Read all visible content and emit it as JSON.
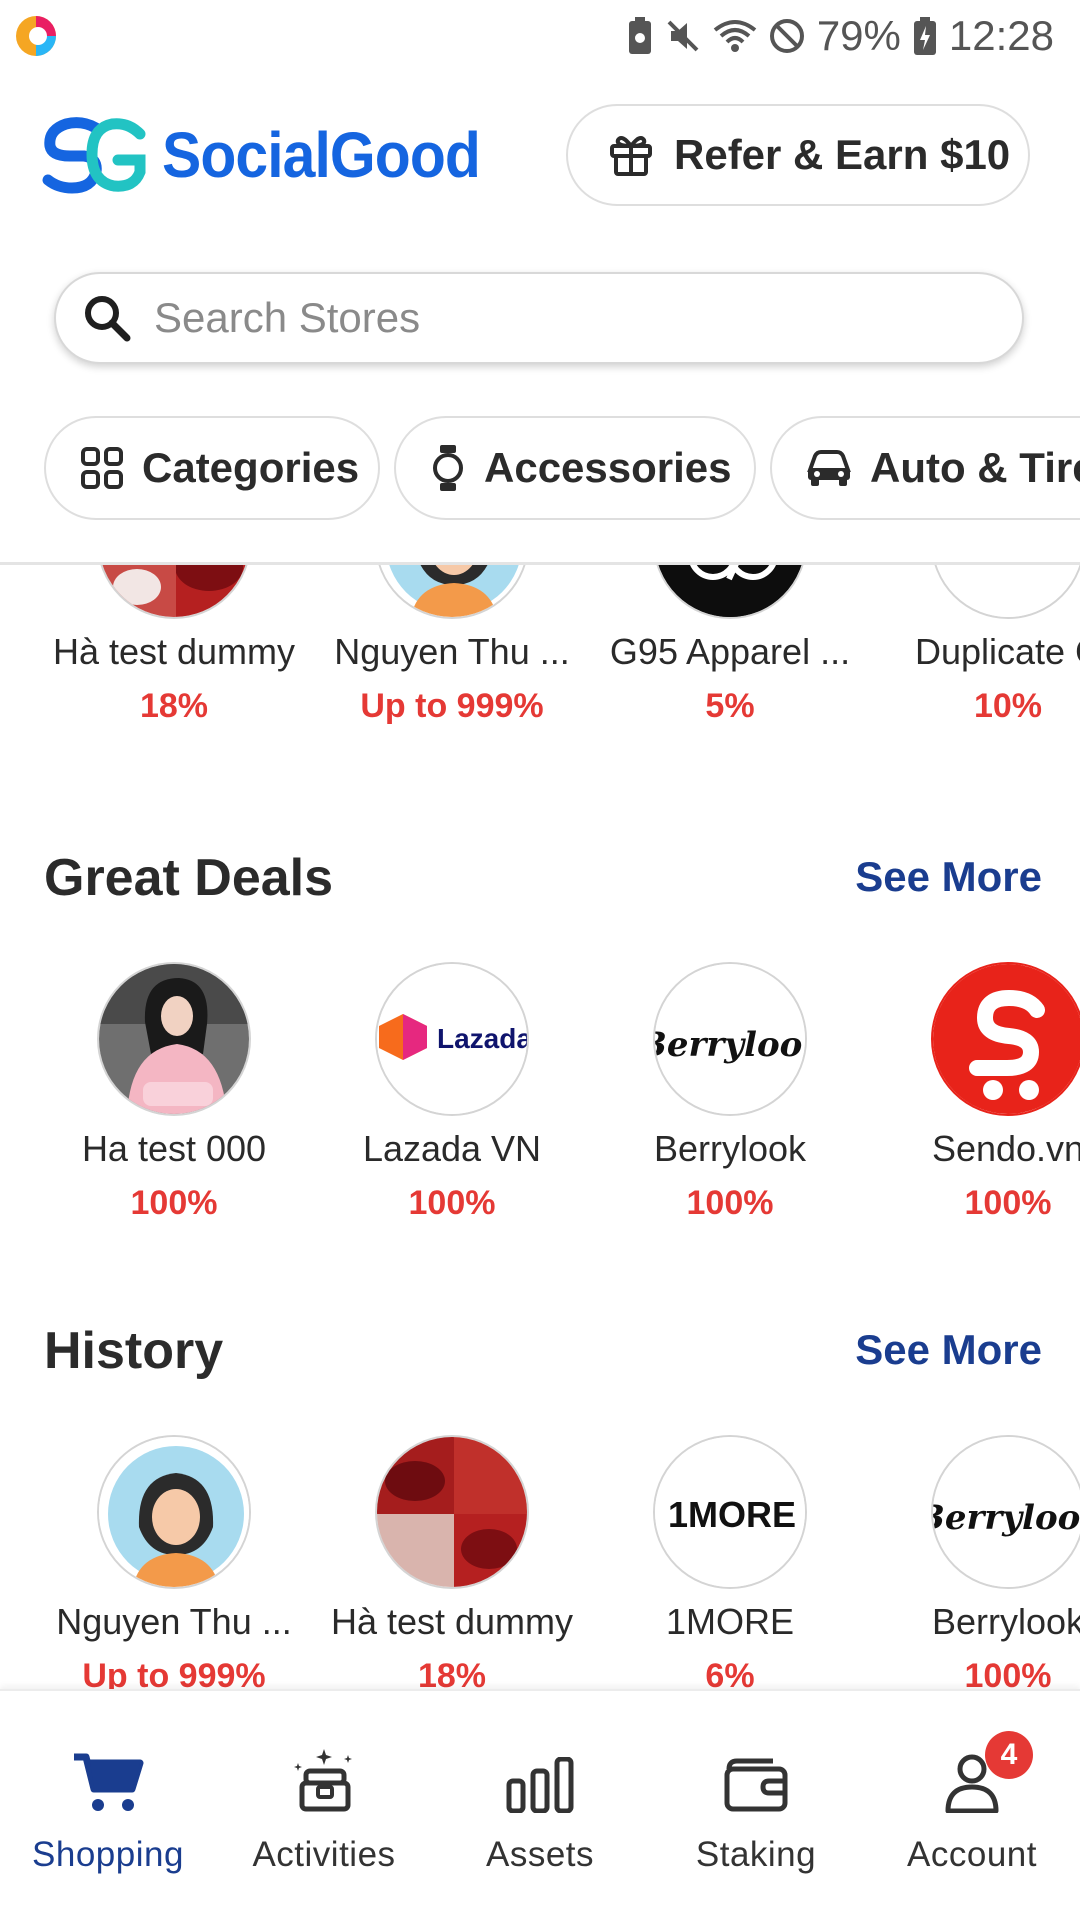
{
  "status_bar": {
    "battery": "79%",
    "time": "12:28"
  },
  "header": {
    "logo_text": "SocialGood",
    "refer_label": "Refer & Earn $10"
  },
  "search": {
    "placeholder": "Search Stores"
  },
  "chips": [
    {
      "label": "Categories",
      "icon": "grid-icon"
    },
    {
      "label": "Accessories",
      "icon": "watch-icon"
    },
    {
      "label": "Auto & Tire",
      "icon": "car-icon"
    }
  ],
  "top_row": [
    {
      "name": "Hà test dummy",
      "rate": "18%",
      "avatar": "lipstick"
    },
    {
      "name": "Nguyen Thu ...",
      "rate": "Up to 999%",
      "avatar": "girl-illustration"
    },
    {
      "name": "G95 Apparel ...",
      "rate": "5%",
      "avatar": "g95-logo"
    },
    {
      "name": "Duplicate C",
      "rate": "10%",
      "avatar": "duplicate-logo"
    }
  ],
  "great_deals": {
    "title": "Great Deals",
    "see_more": "See More",
    "stores": [
      {
        "name": "Ha test 000",
        "rate": "100%",
        "avatar": "photo-girl-pink-hoodie"
      },
      {
        "name": "Lazada VN",
        "rate": "100%",
        "avatar": "lazada-logo",
        "logo_text": "Lazada"
      },
      {
        "name": "Berrylook",
        "rate": "100%",
        "avatar": "berrylook-logo",
        "logo_text": "Berrylook"
      },
      {
        "name": "Sendo.vn",
        "rate": "100%",
        "avatar": "sendo-logo"
      }
    ]
  },
  "history": {
    "title": "History",
    "see_more": "See More",
    "stores": [
      {
        "name": "Nguyen Thu ...",
        "rate": "Up to 999%",
        "avatar": "girl-illustration"
      },
      {
        "name": "Hà test dummy",
        "rate": "18%",
        "avatar": "lipstick"
      },
      {
        "name": "1MORE",
        "rate": "6%",
        "avatar": "1more-logo",
        "logo_text": "1MORE"
      },
      {
        "name": "Berrylook",
        "rate": "100%",
        "avatar": "berrylook-logo",
        "logo_text": "Berrylook"
      }
    ]
  },
  "bottom_nav": [
    {
      "label": "Shopping",
      "icon": "cart-icon",
      "active": true
    },
    {
      "label": "Activities",
      "icon": "gift-box-icon",
      "active": false
    },
    {
      "label": "Assets",
      "icon": "bar-chart-icon",
      "active": false
    },
    {
      "label": "Staking",
      "icon": "wallet-icon",
      "active": false
    },
    {
      "label": "Account",
      "icon": "user-icon",
      "active": false,
      "badge": "4"
    }
  ],
  "colors": {
    "brand_blue": "#1565e0",
    "accent_teal": "#22c3c3",
    "rate_red": "#e53935",
    "link_navy": "#1a3d8f"
  }
}
